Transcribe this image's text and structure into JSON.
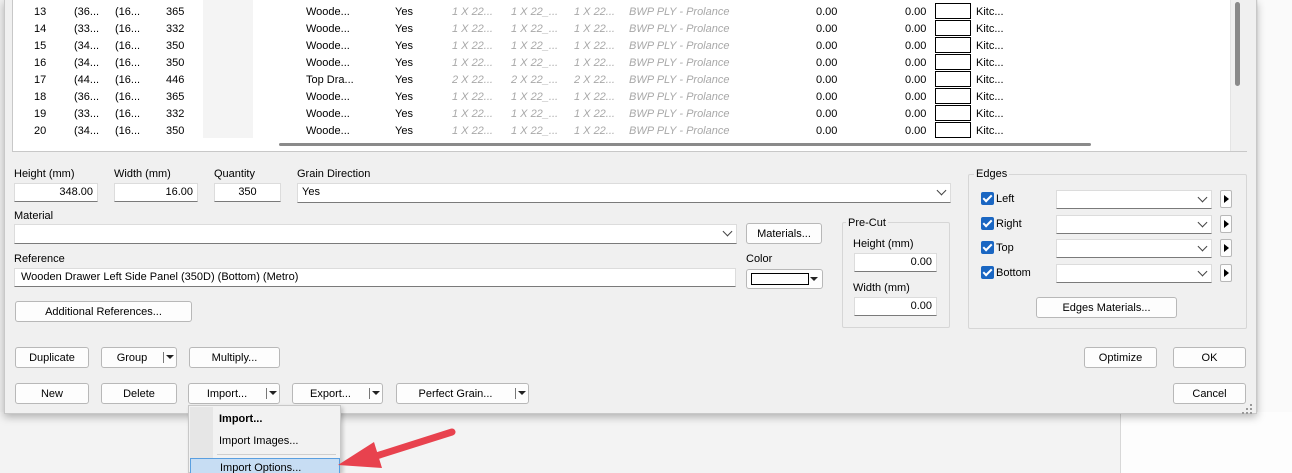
{
  "grid": {
    "rows": [
      {
        "no": "13",
        "c1": "(36...",
        "c2": "(16...",
        "qty": "365",
        "ref": "Woode...",
        "grain": "Yes",
        "e1": "1 X 22...",
        "e2": "1 X 22_...",
        "e3": "1 X 22...",
        "mat": "BWP PLY - Prolance",
        "v1": "0.00",
        "v2": "0.00",
        "cat": "Kitc..."
      },
      {
        "no": "14",
        "c1": "(33...",
        "c2": "(16...",
        "qty": "332",
        "ref": "Woode...",
        "grain": "Yes",
        "e1": "1 X 22...",
        "e2": "1 X 22_...",
        "e3": "1 X 22...",
        "mat": "BWP PLY - Prolance",
        "v1": "0.00",
        "v2": "0.00",
        "cat": "Kitc..."
      },
      {
        "no": "15",
        "c1": "(34...",
        "c2": "(16...",
        "qty": "350",
        "ref": "Woode...",
        "grain": "Yes",
        "e1": "1 X 22...",
        "e2": "1 X 22_...",
        "e3": "1 X 22...",
        "mat": "BWP PLY - Prolance",
        "v1": "0.00",
        "v2": "0.00",
        "cat": "Kitc..."
      },
      {
        "no": "16",
        "c1": "(34...",
        "c2": "(16...",
        "qty": "350",
        "ref": "Woode...",
        "grain": "Yes",
        "e1": "1 X 22...",
        "e2": "1 X 22_...",
        "e3": "1 X 22...",
        "mat": "BWP PLY - Prolance",
        "v1": "0.00",
        "v2": "0.00",
        "cat": "Kitc..."
      },
      {
        "no": "17",
        "c1": "(44...",
        "c2": "(16...",
        "qty": "446",
        "ref": "Top Dra...",
        "grain": "Yes",
        "e1": "2 X 22...",
        "e2": "2 X 22_...",
        "e3": "2 X 22...",
        "mat": "BWP PLY - Prolance",
        "v1": "0.00",
        "v2": "0.00",
        "cat": "Kitc..."
      },
      {
        "no": "18",
        "c1": "(36...",
        "c2": "(16...",
        "qty": "365",
        "ref": "Woode...",
        "grain": "Yes",
        "e1": "1 X 22...",
        "e2": "1 X 22_...",
        "e3": "1 X 22...",
        "mat": "BWP PLY - Prolance",
        "v1": "0.00",
        "v2": "0.00",
        "cat": "Kitc..."
      },
      {
        "no": "19",
        "c1": "(33...",
        "c2": "(16...",
        "qty": "332",
        "ref": "Woode...",
        "grain": "Yes",
        "e1": "1 X 22...",
        "e2": "1 X 22_...",
        "e3": "1 X 22...",
        "mat": "BWP PLY - Prolance",
        "v1": "0.00",
        "v2": "0.00",
        "cat": "Kitc..."
      },
      {
        "no": "20",
        "c1": "(34...",
        "c2": "(16...",
        "qty": "350",
        "ref": "Woode...",
        "grain": "Yes",
        "e1": "1 X 22...",
        "e2": "1 X 22_...",
        "e3": "1 X 22...",
        "mat": "BWP PLY - Prolance",
        "v1": "0.00",
        "v2": "0.00",
        "cat": "Kitc..."
      }
    ]
  },
  "form": {
    "height_label": "Height (mm)",
    "height_value": "348.00",
    "width_label": "Width (mm)",
    "width_value": "16.00",
    "quantity_label": "Quantity",
    "quantity_value": "350",
    "grain_label": "Grain Direction",
    "grain_value": "Yes",
    "material_label": "Material",
    "material_value": "",
    "materials_button": "Materials...",
    "reference_label": "Reference",
    "reference_value": "Wooden Drawer Left Side Panel (350D) (Bottom) (Metro)",
    "color_label": "Color",
    "additional_refs_button": "Additional References..."
  },
  "precut": {
    "title": "Pre-Cut",
    "height_label": "Height (mm)",
    "height_value": "0.00",
    "width_label": "Width (mm)",
    "width_value": "0.00"
  },
  "edges": {
    "title": "Edges",
    "items": [
      {
        "label": "Left"
      },
      {
        "label": "Right"
      },
      {
        "label": "Top"
      },
      {
        "label": "Bottom"
      }
    ],
    "materials_button": "Edges Materials..."
  },
  "buttons": {
    "duplicate": "Duplicate",
    "group": "Group",
    "multiply": "Multiply...",
    "new": "New",
    "delete": "Delete",
    "import": "Import...",
    "export": "Export...",
    "perfect_grain": "Perfect Grain...",
    "optimize": "Optimize",
    "ok": "OK",
    "cancel": "Cancel"
  },
  "import_menu": {
    "items": [
      {
        "label": "Import..."
      },
      {
        "label": "Import Images..."
      },
      {
        "label": "Import Options..."
      }
    ]
  },
  "colors": {
    "accent": "#1a66c2",
    "annotation_arrow": "#e8424e",
    "menu_highlight": "#c7ddf3"
  }
}
